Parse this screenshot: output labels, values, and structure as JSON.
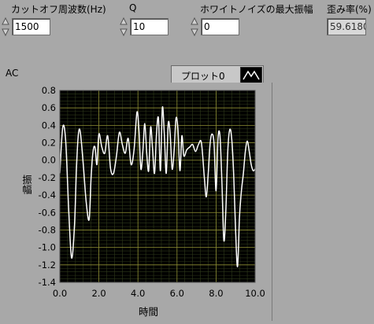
{
  "controls": {
    "cutoff": {
      "label": "カットオフ周波数(Hz)",
      "value": "1500"
    },
    "q": {
      "label": "Q",
      "value": "10"
    },
    "noise": {
      "label": "ホワイトノイズの最大振幅",
      "value": "0"
    },
    "distortion": {
      "label": "歪み率(%)",
      "value": "59.6180"
    }
  },
  "graph": {
    "title": "AC",
    "legend_label": "プロット0"
  },
  "chart_data": {
    "type": "line",
    "title": "AC",
    "xlabel": "時間",
    "ylabel": "振幅",
    "xlim": [
      0,
      10
    ],
    "ylim": [
      -1.4,
      0.8
    ],
    "xticks": [
      "0.0",
      "2.0",
      "4.0",
      "6.0",
      "8.0",
      "10.0"
    ],
    "yticks": [
      "0.8",
      "0.6",
      "0.4",
      "0.2",
      "0.0",
      "-0.2",
      "-0.4",
      "-0.6",
      "-0.8",
      "-1.0",
      "-1.2",
      "-1.4"
    ],
    "grid": true,
    "series": [
      {
        "name": "プロット0",
        "color": "#ffffff",
        "x": [
          0.0,
          0.15,
          0.3,
          0.45,
          0.6,
          0.75,
          0.85,
          0.95,
          1.05,
          1.2,
          1.35,
          1.5,
          1.6,
          1.7,
          1.8,
          1.9,
          2.0,
          2.15,
          2.3,
          2.45,
          2.6,
          2.75,
          2.9,
          3.05,
          3.2,
          3.35,
          3.5,
          3.65,
          3.8,
          3.95,
          4.05,
          4.15,
          4.25,
          4.35,
          4.45,
          4.55,
          4.65,
          4.75,
          4.85,
          4.95,
          5.05,
          5.15,
          5.25,
          5.35,
          5.45,
          5.55,
          5.65,
          5.75,
          5.85,
          5.95,
          6.05,
          6.15,
          6.25,
          6.35,
          6.5,
          6.65,
          6.8,
          6.95,
          7.1,
          7.25,
          7.4,
          7.5,
          7.6,
          7.7,
          7.8,
          7.9,
          8.0,
          8.1,
          8.2,
          8.3,
          8.4,
          8.5,
          8.6,
          8.7,
          8.8,
          8.9,
          9.0,
          9.1,
          9.2,
          9.3,
          9.4,
          9.5,
          9.6,
          9.7,
          9.8,
          9.9,
          10.0
        ],
        "y": [
          -0.15,
          0.38,
          0.22,
          -0.55,
          -1.12,
          -0.75,
          -0.1,
          0.3,
          0.32,
          -0.05,
          -0.48,
          -0.68,
          -0.2,
          0.1,
          0.15,
          -0.05,
          0.3,
          0.15,
          0.08,
          0.28,
          -0.1,
          -0.15,
          0.05,
          0.32,
          0.18,
          0.08,
          0.25,
          -0.05,
          0.12,
          0.55,
          0.35,
          -0.1,
          0.1,
          0.42,
          0.08,
          -0.12,
          0.38,
          0.12,
          -0.15,
          0.3,
          0.48,
          -0.12,
          0.6,
          0.3,
          -0.15,
          0.42,
          0.3,
          -0.1,
          0.1,
          0.48,
          0.35,
          -0.12,
          0.28,
          0.05,
          0.12,
          0.15,
          0.18,
          0.1,
          0.18,
          0.2,
          -0.2,
          -0.42,
          -0.15,
          0.2,
          0.3,
          0.18,
          -0.35,
          0.25,
          0.28,
          -0.25,
          -0.92,
          -0.58,
          0.1,
          0.35,
          0.25,
          -0.15,
          -0.8,
          -1.22,
          -0.65,
          -0.35,
          -0.15,
          0.1,
          0.22,
          0.1,
          -0.05,
          -0.12,
          -0.1
        ]
      }
    ]
  }
}
